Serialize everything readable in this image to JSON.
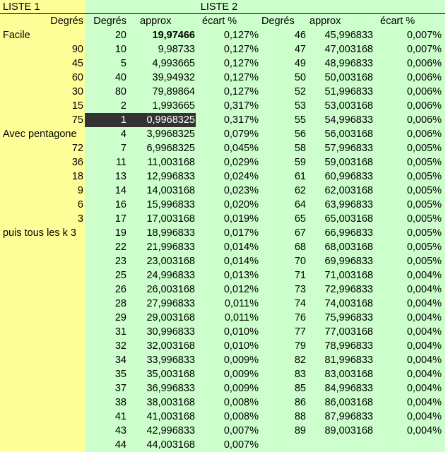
{
  "sheet": {
    "title_list1": "LISTE 1",
    "title_list2": "LISTE 2",
    "list1_header": "Degrés",
    "list1_items": [
      "Facile",
      "90",
      "45",
      "60",
      "30",
      "15",
      "75",
      "Avec pentagone",
      "72",
      "36",
      "18",
      "9",
      "6",
      "3",
      "puis tous les k 3"
    ],
    "list1_align": [
      "l",
      "r",
      "r",
      "r",
      "r",
      "r",
      "r",
      "l",
      "r",
      "r",
      "r",
      "r",
      "r",
      "r",
      "l"
    ],
    "list2_headers": {
      "deg1": "Degrés",
      "approx1": "approx",
      "ecart1": "écart %",
      "deg2": "Degrés",
      "approx2": "approx",
      "ecart2": "écart %"
    },
    "table_left": [
      [
        "20",
        "19,97466",
        "0,127%"
      ],
      [
        "10",
        "9,98733",
        "0,127%"
      ],
      [
        "5",
        "4,993665",
        "0,127%"
      ],
      [
        "40",
        "39,94932",
        "0,127%"
      ],
      [
        "80",
        "79,89864",
        "0,127%"
      ],
      [
        "2",
        "1,993665",
        "0,317%"
      ],
      [
        "1",
        "0,9968325",
        "0,317%"
      ],
      [
        "4",
        "3,9968325",
        "0,079%"
      ],
      [
        "7",
        "6,9968325",
        "0,045%"
      ],
      [
        "11",
        "11,003168",
        "0,029%"
      ],
      [
        "13",
        "12,996833",
        "0,024%"
      ],
      [
        "14",
        "14,003168",
        "0,023%"
      ],
      [
        "16",
        "15,996833",
        "0,020%"
      ],
      [
        "17",
        "17,003168",
        "0,019%"
      ],
      [
        "19",
        "18,996833",
        "0,017%"
      ],
      [
        "22",
        "21,996833",
        "0,014%"
      ],
      [
        "23",
        "23,003168",
        "0,014%"
      ],
      [
        "25",
        "24,996833",
        "0,013%"
      ],
      [
        "26",
        "26,003168",
        "0,012%"
      ],
      [
        "28",
        "27,996833",
        "0,011%"
      ],
      [
        "29",
        "29,003168",
        "0,011%"
      ],
      [
        "31",
        "30,996833",
        "0,010%"
      ],
      [
        "32",
        "32,003168",
        "0,010%"
      ],
      [
        "34",
        "33,996833",
        "0,009%"
      ],
      [
        "35",
        "35,003168",
        "0,009%"
      ],
      [
        "37",
        "36,996833",
        "0,009%"
      ],
      [
        "38",
        "38,003168",
        "0,008%"
      ],
      [
        "41",
        "41,003168",
        "0,008%"
      ],
      [
        "43",
        "42,996833",
        "0,007%"
      ],
      [
        "44",
        "44,003168",
        "0,007%"
      ]
    ],
    "table_right": [
      [
        "46",
        "45,996833",
        "0,007%"
      ],
      [
        "47",
        "47,003168",
        "0,007%"
      ],
      [
        "49",
        "48,996833",
        "0,006%"
      ],
      [
        "50",
        "50,003168",
        "0,006%"
      ],
      [
        "52",
        "51,996833",
        "0,006%"
      ],
      [
        "53",
        "53,003168",
        "0,006%"
      ],
      [
        "55",
        "54,996833",
        "0,006%"
      ],
      [
        "56",
        "56,003168",
        "0,006%"
      ],
      [
        "58",
        "57,996833",
        "0,005%"
      ],
      [
        "59",
        "59,003168",
        "0,005%"
      ],
      [
        "61",
        "60,996833",
        "0,005%"
      ],
      [
        "62",
        "62,003168",
        "0,005%"
      ],
      [
        "64",
        "63,996833",
        "0,005%"
      ],
      [
        "65",
        "65,003168",
        "0,005%"
      ],
      [
        "67",
        "66,996833",
        "0,005%"
      ],
      [
        "68",
        "68,003168",
        "0,005%"
      ],
      [
        "70",
        "69,996833",
        "0,005%"
      ],
      [
        "71",
        "71,003168",
        "0,004%"
      ],
      [
        "73",
        "72,996833",
        "0,004%"
      ],
      [
        "74",
        "74,003168",
        "0,004%"
      ],
      [
        "76",
        "75,996833",
        "0,004%"
      ],
      [
        "77",
        "77,003168",
        "0,004%"
      ],
      [
        "79",
        "78,996833",
        "0,004%"
      ],
      [
        "82",
        "81,996833",
        "0,004%"
      ],
      [
        "83",
        "83,003168",
        "0,004%"
      ],
      [
        "85",
        "84,996833",
        "0,004%"
      ],
      [
        "86",
        "86,003168",
        "0,004%"
      ],
      [
        "88",
        "87,996833",
        "0,004%"
      ],
      [
        "89",
        "89,003168",
        "0,004%"
      ]
    ],
    "bold_cell": {
      "row": 0,
      "col": 1
    },
    "selected_row": 6,
    "colors": {
      "list1_bg": "#ffff99",
      "list2_bg": "#ccffcc",
      "selection_bg": "#333333",
      "selection_text": "#ffffff"
    }
  }
}
